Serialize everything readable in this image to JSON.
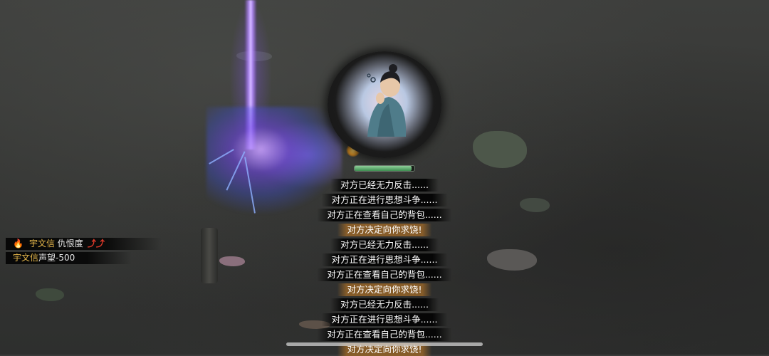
{
  "messages": [
    {
      "text": "对方已经无力反击......",
      "type": "normal"
    },
    {
      "text": "对方正在进行思想斗争......",
      "type": "normal"
    },
    {
      "text": "对方正在查看自己的背包......",
      "type": "normal"
    },
    {
      "text": "对方决定向你求饶!",
      "type": "beg"
    },
    {
      "text": "对方已经无力反击......",
      "type": "normal"
    },
    {
      "text": "对方正在进行思想斗争......",
      "type": "normal"
    },
    {
      "text": "对方正在查看自己的背包......",
      "type": "normal"
    },
    {
      "text": "对方决定向你求饶!",
      "type": "beg"
    },
    {
      "text": "对方已经无力反击......",
      "type": "normal"
    },
    {
      "text": "对方正在进行思想斗争......",
      "type": "normal"
    },
    {
      "text": "对方正在查看自己的背包......",
      "type": "normal"
    },
    {
      "text": "对方决定向你求饶!",
      "type": "beg"
    }
  ],
  "log": {
    "hatred": {
      "icon": "fire-icon",
      "name": "宇文信",
      "text": "仇恨度",
      "arrows": "⤴⤴"
    },
    "reputation": {
      "name": "宇文信",
      "text": "声望-500"
    }
  },
  "opponent": {
    "hp_fraction": 0.95
  },
  "colors": {
    "name_gold": "#e3b54a",
    "beg_bg": "#966428",
    "hatred_arrow": "#e23a2a",
    "skill_purple": "#b890ff"
  }
}
